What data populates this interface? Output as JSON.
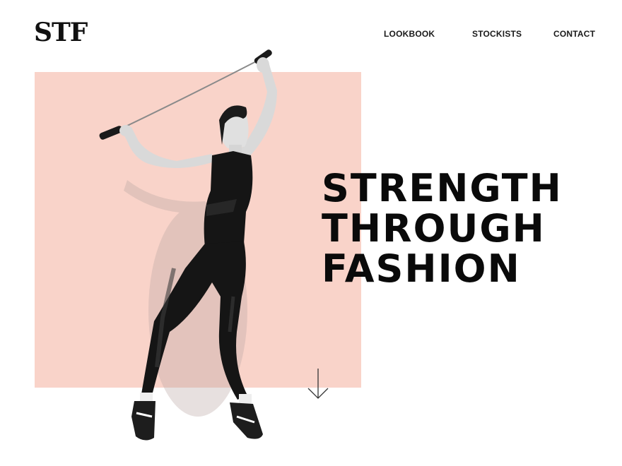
{
  "brand": {
    "logo_text": "STF"
  },
  "nav": {
    "items": [
      {
        "label": "LOOKBOOK"
      },
      {
        "label": "STOCKISTS"
      },
      {
        "label": "CONTACT"
      }
    ]
  },
  "hero": {
    "headline_lines": [
      "STRENGTH",
      "THROUGH",
      "FASHION"
    ],
    "scroll_icon": "arrow-down-icon",
    "figure_icon": "model-with-jump-rope"
  },
  "colors": {
    "background": "#ffffff",
    "accent_block": "#f9d3c9",
    "text": "#0a0a0a",
    "outfit": "#151515"
  }
}
